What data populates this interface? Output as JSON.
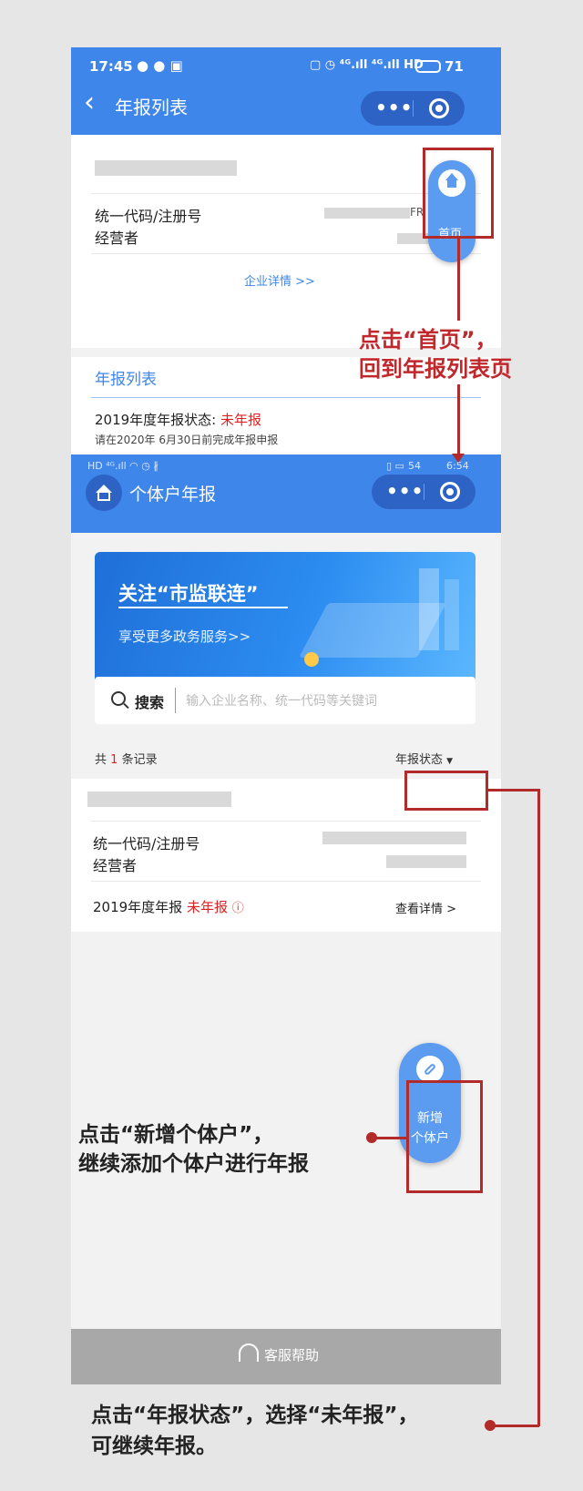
{
  "screen1": {
    "status_time": "17:45",
    "status_icons": "▢ ◷ ⁴ᴳ.ıll ⁴ᴳ.ıll HD",
    "battery": "71",
    "title": "年报列表",
    "code_label": "统一代码/注册号",
    "operator_label": "经营者",
    "code_partial": "FR",
    "enterprise_detail_link": "企业详情 >>",
    "float_home_label": "首页",
    "section_title": "年报列表",
    "report_status_label": "2019年度年报状态:",
    "report_status_value": "未年报",
    "deadline_note": "请在2020年 6月30日前完成年报申报"
  },
  "screen2": {
    "status_left": "HD ⁴ᴳ.ıll ◠ ◷ ∦",
    "status_right": "54",
    "status_time": "6:54",
    "title": "个体户年报",
    "banner_title": "关注“市监联连”",
    "banner_subtitle": "享受更多政务服务>>",
    "search_label": "搜索",
    "search_placeholder": "输入企业名称、统一代码等关键词",
    "records_prefix": "共",
    "records_count": "1",
    "records_suffix": "条记录",
    "filter_label": "年报状态",
    "code_label": "统一代码/注册号",
    "operator_label": "经营者",
    "report_year": "2019年度年报",
    "report_status": "未年报",
    "view_detail": "查看详情",
    "add_button_line1": "新增",
    "add_button_line2": "个体户",
    "service_help": "客服帮助"
  },
  "annotations": {
    "home_line1": "点击“首页”，",
    "home_line2": "回到年报列表页",
    "add_line1": "点击“新增个体户”，",
    "add_line2": "继续添加个体户进行年报",
    "status_line1": "点击“年报状态”，选择“未年报”，",
    "status_line2": "可继续年报。"
  },
  "colors": {
    "brand_blue": "#3f86ea",
    "status_red": "#e02020",
    "annotation_red": "#b22a2a"
  }
}
